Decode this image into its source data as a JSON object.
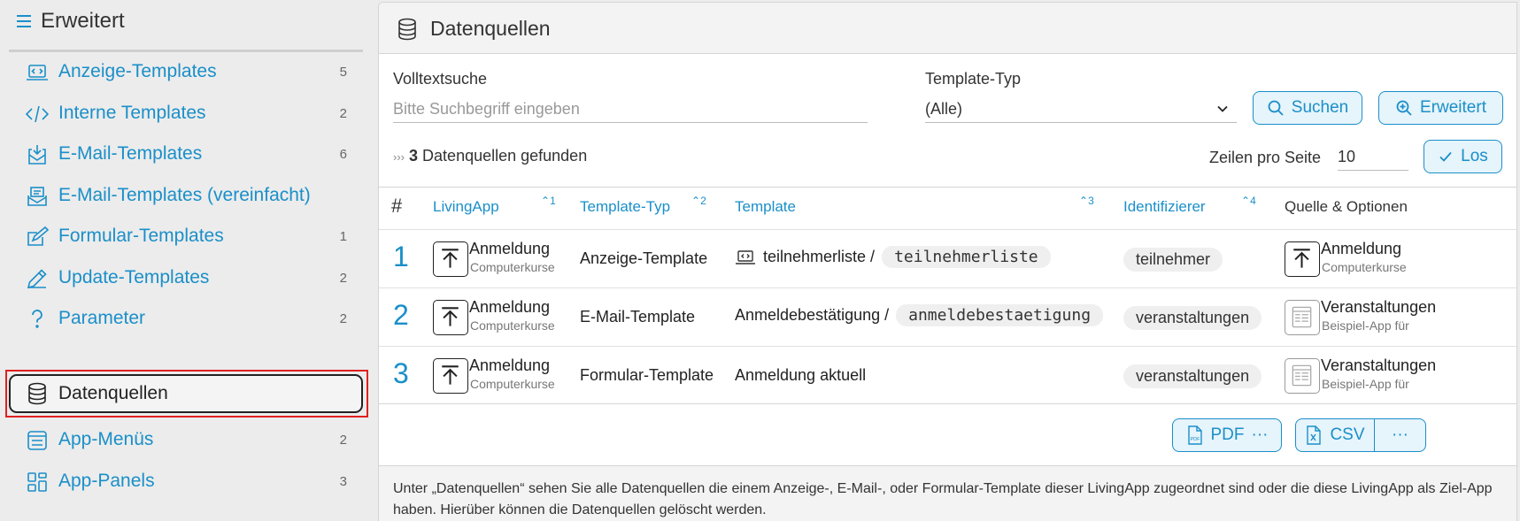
{
  "sidebar": {
    "title": "Erweitert",
    "items": [
      {
        "label": "Anzeige-Templates",
        "count": "5",
        "icon": "laptop-code-icon"
      },
      {
        "label": "Interne Templates",
        "count": "2",
        "icon": "code-icon"
      },
      {
        "label": "E-Mail-Templates",
        "count": "6",
        "icon": "envelope-download-icon"
      },
      {
        "label": "E-Mail-Templates (vereinfacht)",
        "count": "",
        "icon": "envelope-tray-icon"
      },
      {
        "label": "Formular-Templates",
        "count": "1",
        "icon": "form-edit-icon"
      },
      {
        "label": "Update-Templates",
        "count": "2",
        "icon": "pencil-icon"
      },
      {
        "label": "Parameter",
        "count": "2",
        "icon": "question-icon"
      },
      {
        "label": "Datenquellen",
        "count": "",
        "icon": "database-icon",
        "active": true
      },
      {
        "label": "App-Menüs",
        "count": "2",
        "icon": "menu-list-icon"
      },
      {
        "label": "App-Panels",
        "count": "3",
        "icon": "panels-icon"
      }
    ]
  },
  "panel": {
    "title": "Datenquellen",
    "search": {
      "label": "Volltextsuche",
      "placeholder": "Bitte Suchbegriff eingeben",
      "value": ""
    },
    "type_filter": {
      "label": "Template-Typ",
      "selected": "(Alle)"
    },
    "buttons": {
      "search": "Suchen",
      "advanced": "Erweitert",
      "go": "Los"
    },
    "found": {
      "count": "3",
      "text": "Datenquellen gefunden",
      "marker": "›››"
    },
    "rows_per_page": {
      "label": "Zeilen pro Seite",
      "value": "10"
    },
    "table": {
      "headers": {
        "num": "#",
        "app": "LivingApp",
        "type": "Template-Typ",
        "template": "Template",
        "identifier": "Identifizierer",
        "source": "Quelle & Optionen"
      },
      "sort_marks": {
        "app": "1",
        "type": "2",
        "template": "3",
        "identifier": "4"
      },
      "rows": [
        {
          "num": "1",
          "app_title": "Anmeldung",
          "app_sub": "Computerkurse",
          "type": "Anzeige-Template",
          "template_name": "teilnehmerliste /",
          "template_code": "teilnehmerliste",
          "has_template_icon": true,
          "identifier": "teilnehmer",
          "source_title": "Anmeldung",
          "source_sub": "Computerkurse",
          "source_icon": "upload-icon"
        },
        {
          "num": "2",
          "app_title": "Anmeldung",
          "app_sub": "Computerkurse",
          "type": "E-Mail-Template",
          "template_name": "Anmeldebestätigung /",
          "template_code": "anmeldebestaetigung",
          "has_template_icon": false,
          "identifier": "veranstaltungen",
          "source_title": "Veranstaltungen",
          "source_sub": "Beispiel-App für",
          "source_icon": "form-doc-icon"
        },
        {
          "num": "3",
          "app_title": "Anmeldung",
          "app_sub": "Computerkurse",
          "type": "Formular-Template",
          "template_name": "Anmeldung aktuell",
          "template_code": "",
          "has_template_icon": false,
          "identifier": "veranstaltungen",
          "source_title": "Veranstaltungen",
          "source_sub": "Beispiel-App für",
          "source_icon": "form-doc-icon"
        }
      ]
    },
    "export": {
      "pdf": "PDF",
      "pdf_more": "···",
      "csv": "CSV",
      "more": "···"
    },
    "description": "Unter „Datenquellen“ sehen Sie alle Datenquellen die einem Anzeige-, E-Mail-, oder Formular-Template dieser LivingApp zugeordnet sind oder die diese LivingApp als Ziel-App haben. Hierüber können die Datenquellen gelöscht werden."
  },
  "colors": {
    "accent": "#1a8fc9",
    "focus": "#e02020"
  }
}
